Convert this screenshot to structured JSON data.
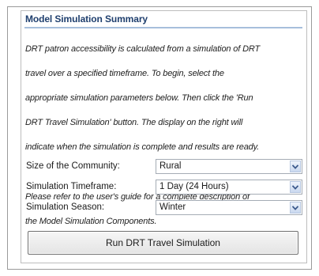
{
  "panel": {
    "title": "Model Simulation Summary",
    "description_lines": [
      "DRT patron accessibility is calculated from a simulation of DRT",
      "travel over a specified timeframe.  To begin, select the",
      "appropriate simulation parameters below.  Then click the 'Run",
      "DRT Travel Simulation' button.  The display on the right will",
      "indicate when the simulation is complete and results are ready."
    ],
    "guide_lines": [
      "Please refer to the user's guide for a complete description of",
      "the Model Simulation Components."
    ]
  },
  "params": {
    "community": {
      "label": "Size of the Community:",
      "value": "Rural"
    },
    "timeframe": {
      "label": "Simulation Timeframe:",
      "value": "1 Day (24 Hours)"
    },
    "season": {
      "label": "Simulation Season:",
      "value": "Winter"
    }
  },
  "run_button": {
    "label": "Run DRT Travel Simulation"
  },
  "colors": {
    "title": "#1f3f6e",
    "title_rule": "#a7bfdc",
    "dropdown_arrow": "#3c5a8c"
  },
  "icons": {
    "dropdown": "chevron-down-icon"
  }
}
